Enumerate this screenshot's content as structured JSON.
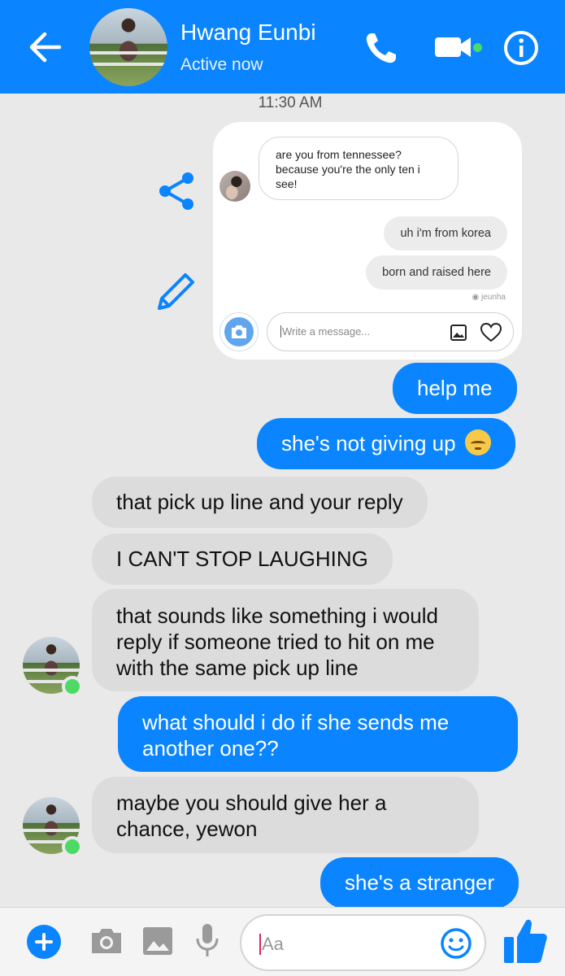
{
  "header": {
    "contact_name": "Hwang Eunbi",
    "status": "Active now"
  },
  "timestamp": "11:30 AM",
  "screenshot_card": {
    "incoming_message": "are you from tennessee? because you're the only ten i see!",
    "replies": [
      "uh i'm from korea",
      "born and raised here"
    ],
    "watermark": "jeunha",
    "composer_placeholder": "Write a message..."
  },
  "messages": [
    {
      "direction": "outgoing",
      "text": "help me"
    },
    {
      "direction": "outgoing",
      "text": "she's not giving up",
      "emoji": "disappointed-face"
    },
    {
      "direction": "incoming",
      "text": "that pick up line and your reply"
    },
    {
      "direction": "incoming",
      "text": "I CAN'T STOP LAUGHING"
    },
    {
      "direction": "incoming",
      "text": "that sounds like something i would\nreply if someone tried to hit on me\nwith the same pick up line"
    },
    {
      "direction": "outgoing",
      "text": "what should i do if she sends me\nanother one??"
    },
    {
      "direction": "incoming",
      "text": "maybe you should give her a\nchance, yewon"
    },
    {
      "direction": "outgoing",
      "text": "she's a stranger"
    }
  ],
  "composer": {
    "placeholder": "Aa"
  },
  "colors": {
    "brand_blue": "#0a84ff",
    "online_green": "#4cd964",
    "incoming_bubble": "#dcdcdc",
    "background": "#e9e9e9"
  },
  "icons": [
    "back-arrow-icon",
    "phone-icon",
    "video-camera-icon",
    "info-icon",
    "share-icon",
    "edit-pencil-icon",
    "plus-icon",
    "camera-icon",
    "gallery-icon",
    "microphone-icon",
    "emoji-icon",
    "thumbs-up-icon"
  ]
}
